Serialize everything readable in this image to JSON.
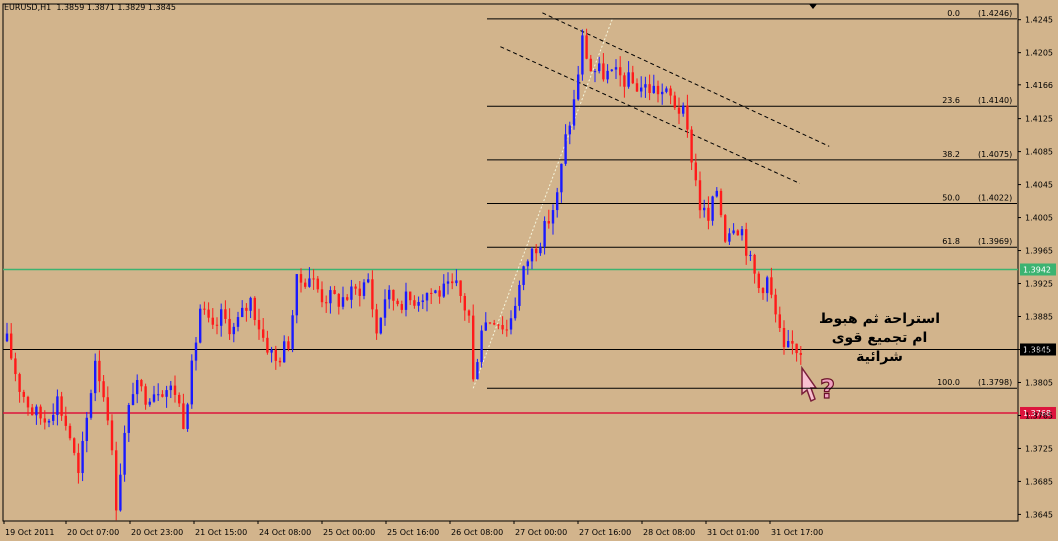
{
  "header": {
    "symbol": "EURUSD,H1",
    "ohlc": "1.3859 1.3871 1.3829 1.3845"
  },
  "annotation": {
    "lines": [
      "استراحة ثم هبوط",
      "ام تجميع قوى",
      "شرائية"
    ]
  },
  "colors": {
    "background": "#d2b48c",
    "bull_candle": "#1a1aff",
    "bear_candle": "#ff1a1a",
    "grid_line": "#000000",
    "green_level": "#3cb371",
    "red_level": "#dc143c",
    "trend_dash": "#000000",
    "fib_diag": "#f5f5dc"
  },
  "chart_data": {
    "type": "candlestick",
    "timeframe": "H1",
    "ylim": [
      1.3637,
      1.4264
    ],
    "y_ticks": [
      1.4245,
      1.4205,
      1.4166,
      1.4125,
      1.4085,
      1.4045,
      1.4005,
      1.3965,
      1.3925,
      1.3885,
      1.3845,
      1.3805,
      1.3765,
      1.3725,
      1.3685,
      1.3645
    ],
    "x_ticks": [
      "19 Oct 2011",
      "20 Oct 07:00",
      "20 Oct 23:00",
      "21 Oct 15:00",
      "24 Oct 08:00",
      "25 Oct 00:00",
      "25 Oct 16:00",
      "26 Oct 08:00",
      "27 Oct 00:00",
      "27 Oct 16:00",
      "28 Oct 08:00",
      "31 Oct 01:00",
      "31 Oct 17:00"
    ],
    "fibonacci": {
      "levels": [
        {
          "ratio": "0.0",
          "price": "1.4246"
        },
        {
          "ratio": "23.6",
          "price": "1.4140"
        },
        {
          "ratio": "38.2",
          "price": "1.4075"
        },
        {
          "ratio": "50.0",
          "price": "1.4022"
        },
        {
          "ratio": "61.8",
          "price": "1.3969"
        },
        {
          "ratio": "100.0",
          "price": "1.3798"
        }
      ],
      "swing_low_bar": 111,
      "swing_high_bar": 137
    },
    "horizontal_lines": [
      {
        "price": 1.3942,
        "label": "1.3942",
        "color": "green"
      },
      {
        "price": 1.3845,
        "label": "1.3845",
        "color": "black"
      },
      {
        "price": 1.3768,
        "label": "1.3768",
        "color": "red"
      }
    ],
    "channel": {
      "upper": {
        "from": [
          137,
          1.4246
        ],
        "to": [
          191,
          1.4095
        ]
      },
      "lower": {
        "from": [
          127,
          1.4205
        ],
        "to": [
          184,
          1.405
        ]
      }
    },
    "close_path": [
      [
        0,
        1.3855
      ],
      [
        3,
        1.38
      ],
      [
        6,
        1.377
      ],
      [
        9,
        1.376
      ],
      [
        12,
        1.3785
      ],
      [
        15,
        1.374
      ],
      [
        17,
        1.369
      ],
      [
        19,
        1.376
      ],
      [
        21,
        1.3835
      ],
      [
        24,
        1.377
      ],
      [
        26,
        1.366
      ],
      [
        28,
        1.374
      ],
      [
        30,
        1.38
      ],
      [
        33,
        1.379
      ],
      [
        36,
        1.38
      ],
      [
        40,
        1.3795
      ],
      [
        42,
        1.376
      ],
      [
        44,
        1.382
      ],
      [
        46,
        1.3895
      ],
      [
        49,
        1.3865
      ],
      [
        51,
        1.3885
      ],
      [
        54,
        1.387
      ],
      [
        58,
        1.3905
      ],
      [
        61,
        1.386
      ],
      [
        64,
        1.383
      ],
      [
        67,
        1.3855
      ],
      [
        69,
        1.3925
      ],
      [
        72,
        1.3935
      ],
      [
        75,
        1.391
      ],
      [
        79,
        1.3905
      ],
      [
        83,
        1.3915
      ],
      [
        86,
        1.393
      ],
      [
        88,
        1.3865
      ],
      [
        90,
        1.391
      ],
      [
        93,
        1.3905
      ],
      [
        96,
        1.3905
      ],
      [
        100,
        1.3915
      ],
      [
        104,
        1.3915
      ],
      [
        107,
        1.392
      ],
      [
        110,
        1.3885
      ],
      [
        111,
        1.3805
      ],
      [
        113,
        1.3875
      ],
      [
        116,
        1.3885
      ],
      [
        119,
        1.387
      ],
      [
        121,
        1.3905
      ],
      [
        124,
        1.3955
      ],
      [
        128,
        1.399
      ],
      [
        131,
        1.403
      ],
      [
        133,
        1.41
      ],
      [
        135,
        1.4145
      ],
      [
        137,
        1.422
      ],
      [
        139,
        1.4185
      ],
      [
        142,
        1.418
      ],
      [
        146,
        1.4175
      ],
      [
        150,
        1.4165
      ],
      [
        155,
        1.416
      ],
      [
        158,
        1.415
      ],
      [
        161,
        1.413
      ],
      [
        163,
        1.408
      ],
      [
        165,
        1.402
      ],
      [
        167,
        1.4
      ],
      [
        169,
        1.404
      ],
      [
        171,
        1.3985
      ],
      [
        173,
        1.4
      ],
      [
        175,
        1.399
      ],
      [
        177,
        1.395
      ],
      [
        179,
        1.392
      ],
      [
        181,
        1.393
      ],
      [
        183,
        1.3885
      ],
      [
        185,
        1.384
      ],
      [
        187,
        1.385
      ],
      [
        189,
        1.3845
      ]
    ],
    "bars_total": 190
  }
}
